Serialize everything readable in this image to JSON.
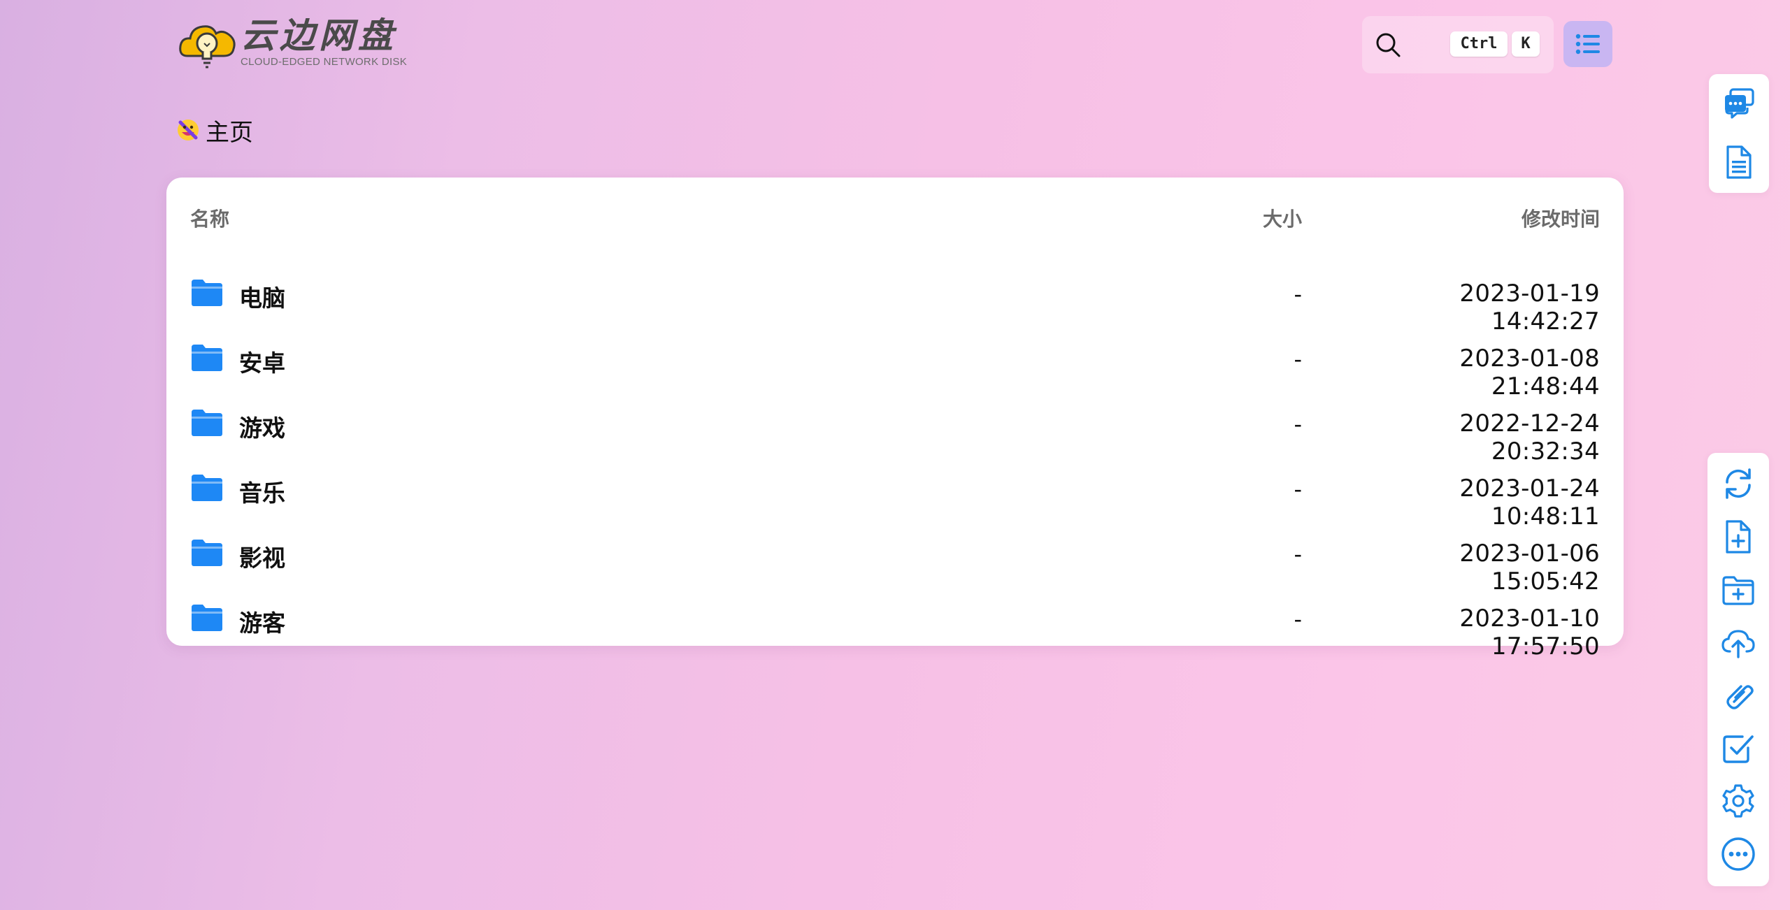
{
  "logo": {
    "title": "云边网盘",
    "subtitle": "CLOUD-EDGED NETWORK DISK"
  },
  "search": {
    "icon": "search-icon",
    "shortcut_ctrl": "Ctrl",
    "shortcut_key": "K"
  },
  "menu": {
    "icon": "list-icon"
  },
  "breadcrumb": {
    "label": "主页",
    "icon": "home-emoji-icon"
  },
  "table": {
    "headers": {
      "name": "名称",
      "size": "大小",
      "modified": "修改时间"
    },
    "rows": [
      {
        "name": "电脑",
        "size": "-",
        "modified": "2023-01-19 14:42:27"
      },
      {
        "name": "安卓",
        "size": "-",
        "modified": "2023-01-08 21:48:44"
      },
      {
        "name": "游戏",
        "size": "-",
        "modified": "2022-12-24 20:32:34"
      },
      {
        "name": "音乐",
        "size": "-",
        "modified": "2023-01-24 10:48:11"
      },
      {
        "name": "影视",
        "size": "-",
        "modified": "2023-01-06 15:05:42"
      },
      {
        "name": "游客",
        "size": "-",
        "modified": "2023-01-10 17:57:50"
      }
    ]
  },
  "right_toolbar_top": [
    "chat-icon",
    "document-icon"
  ],
  "right_toolbar_bottom": [
    "refresh-icon",
    "new-file-icon",
    "new-folder-icon",
    "upload-icon",
    "link-icon",
    "checkbox-icon",
    "settings-icon",
    "more-icon"
  ],
  "colors": {
    "accent": "#1e88e5",
    "folder": "#1e88f5",
    "menu_button_bg": "#c9b6f2"
  }
}
